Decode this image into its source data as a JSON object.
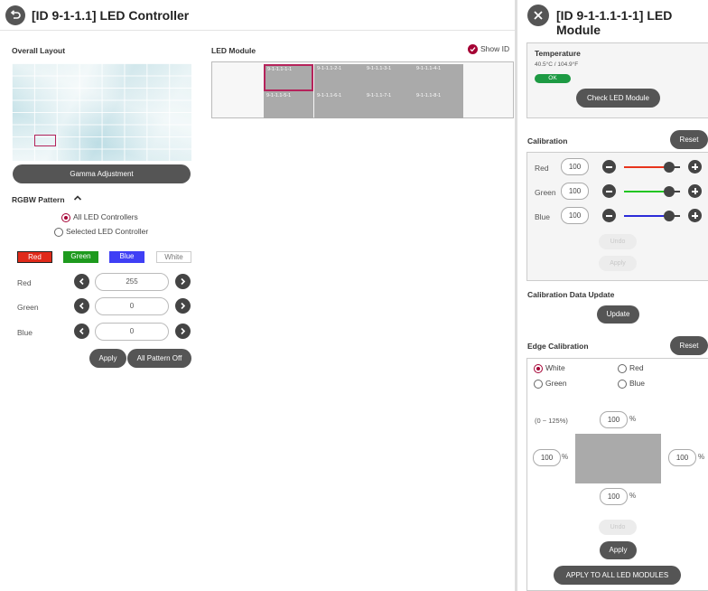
{
  "left": {
    "title": "[ID 9-1-1.1] LED Controller",
    "overall_layout_label": "Overall Layout",
    "gamma_button": "Gamma Adjustment",
    "rgbw_label": "RGBW Pattern",
    "radio_all": "All LED Controllers",
    "radio_selected": "Selected LED Controller",
    "radio_selected_value": "All LED Controllers",
    "swatches": [
      "Red",
      "Green",
      "Blue",
      "White"
    ],
    "selected_swatch": "Red",
    "channels": [
      {
        "label": "Red",
        "value": "255"
      },
      {
        "label": "Green",
        "value": "0"
      },
      {
        "label": "Blue",
        "value": "0"
      }
    ],
    "apply_button": "Apply",
    "pattern_off_button": "All Pattern Off",
    "led_module_label": "LED Module",
    "show_id_label": "Show ID",
    "show_id_checked": true,
    "modules_row1": [
      "9-1-1.1-1-1",
      "9-1-1.1-2-1",
      "9-1-1.1-3-1",
      "9-1-1.1-4-1"
    ],
    "modules_row2": [
      "9-1-1.1-5-1",
      "9-1-1.1-6-1",
      "9-1-1.1-7-1",
      "9-1-1.1-8-1"
    ],
    "selected_module": "9-1-1.1-1-1"
  },
  "right": {
    "title": "[ID 9-1-1.1-1-1] LED Module",
    "temperature_label": "Temperature",
    "temperature_value": "40.5°C / 104.9°F",
    "temperature_status": "OK",
    "check_button": "Check LED Module",
    "calibration_label": "Calibration",
    "reset_label": "Reset",
    "calibration_rows": [
      {
        "label": "Red",
        "value": "100",
        "color": "#e8341c"
      },
      {
        "label": "Green",
        "value": "100",
        "color": "#22c522"
      },
      {
        "label": "Blue",
        "value": "100",
        "color": "#2b2bd8"
      }
    ],
    "undo_label": "Undo",
    "apply_label": "Apply",
    "cal_data_label": "Calibration Data Update",
    "update_button": "Update",
    "edge_label": "Edge Calibration",
    "edge_reset": "Reset",
    "edge_options": [
      "White",
      "Red",
      "Green",
      "Blue"
    ],
    "edge_selected": "White",
    "range_label": "(0 ~ 125%)",
    "edge_top": "100",
    "edge_left": "100",
    "edge_right": "100",
    "edge_bottom": "100",
    "percent": "%",
    "edge_undo": "Undo",
    "edge_apply": "Apply",
    "apply_all_button": "APPLY TO ALL LED MODULES"
  },
  "colors": {
    "accent": "#a50034",
    "dark_button": "#555555",
    "ok_green": "#1d9a43"
  }
}
